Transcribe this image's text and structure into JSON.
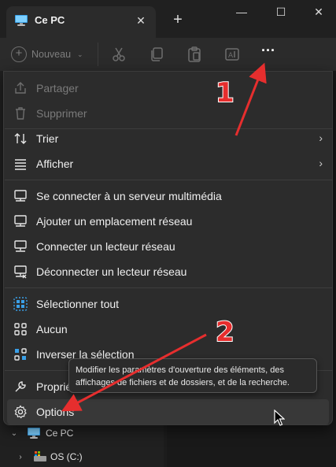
{
  "window": {
    "tab_title": "Ce PC",
    "tab_close": "✕",
    "new_tab": "+",
    "minimize": "—",
    "maximize": "☐",
    "close": "✕"
  },
  "toolbar": {
    "new_label": "Nouveau",
    "more_label": "···",
    "icons": [
      "cut-icon",
      "copy-icon",
      "paste-icon",
      "rename-icon"
    ]
  },
  "menu": {
    "share": "Partager",
    "delete": "Supprimer",
    "sort": "Trier",
    "view": "Afficher",
    "connect_media_server": "Se connecter à un serveur multimédia",
    "add_network_location": "Ajouter un emplacement réseau",
    "map_network_drive": "Connecter un lecteur réseau",
    "disconnect_network_drive": "Déconnecter un lecteur réseau",
    "select_all": "Sélectionner tout",
    "select_none": "Aucun",
    "invert_selection": "Inverser la sélection",
    "properties": "Propriétés",
    "options": "Options",
    "submenu_arrow": "›"
  },
  "tooltip": {
    "text": "Modifier les paramètres d'ouverture des éléments, des affichages de fichiers et de dossiers, et de la recherche."
  },
  "nav_tree": {
    "this_pc": "Ce PC",
    "drive": "OS (C:)"
  },
  "annotations": {
    "step1": "1",
    "step2": "2",
    "color": "#e62e2e"
  }
}
